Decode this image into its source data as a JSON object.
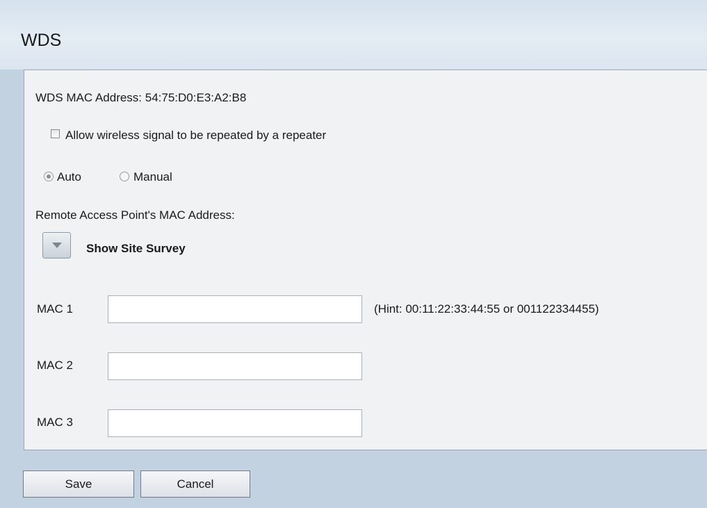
{
  "page": {
    "title": "WDS"
  },
  "wds": {
    "mac_address_label": "WDS MAC Address: 54:75:D0:E3:A2:B8",
    "repeater_checkbox_label": "Allow wireless signal to be repeated by a repeater",
    "repeater_checked": false,
    "mode_auto_label": "Auto",
    "mode_manual_label": "Manual",
    "selected_mode": "Auto",
    "remote_ap_label": "Remote Access Point's MAC Address:",
    "site_survey_label": "Show Site Survey"
  },
  "mac_fields": [
    {
      "label": "MAC 1",
      "value": "",
      "hint": "(Hint: 00:11:22:33:44:55 or 001122334455)"
    },
    {
      "label": "MAC 2",
      "value": ""
    },
    {
      "label": "MAC 3",
      "value": ""
    }
  ],
  "buttons": {
    "save_label": "Save",
    "cancel_label": "Cancel"
  }
}
